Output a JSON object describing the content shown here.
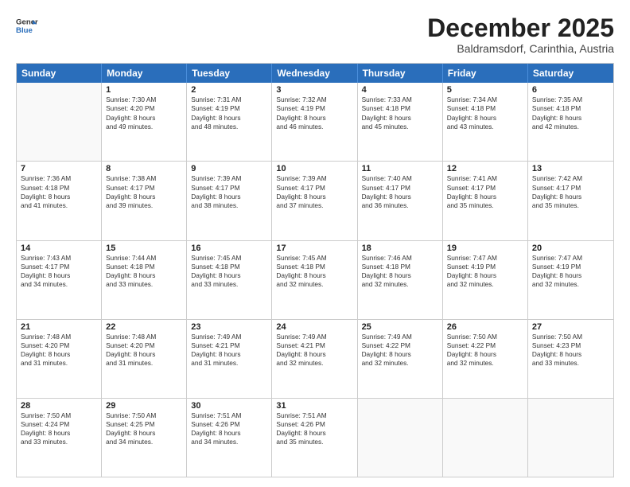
{
  "header": {
    "logo_line1": "General",
    "logo_line2": "Blue",
    "month_year": "December 2025",
    "location": "Baldramsdorf, Carinthia, Austria"
  },
  "weekdays": [
    "Sunday",
    "Monday",
    "Tuesday",
    "Wednesday",
    "Thursday",
    "Friday",
    "Saturday"
  ],
  "rows": [
    [
      {
        "day": "",
        "lines": []
      },
      {
        "day": "1",
        "lines": [
          "Sunrise: 7:30 AM",
          "Sunset: 4:20 PM",
          "Daylight: 8 hours",
          "and 49 minutes."
        ]
      },
      {
        "day": "2",
        "lines": [
          "Sunrise: 7:31 AM",
          "Sunset: 4:19 PM",
          "Daylight: 8 hours",
          "and 48 minutes."
        ]
      },
      {
        "day": "3",
        "lines": [
          "Sunrise: 7:32 AM",
          "Sunset: 4:19 PM",
          "Daylight: 8 hours",
          "and 46 minutes."
        ]
      },
      {
        "day": "4",
        "lines": [
          "Sunrise: 7:33 AM",
          "Sunset: 4:18 PM",
          "Daylight: 8 hours",
          "and 45 minutes."
        ]
      },
      {
        "day": "5",
        "lines": [
          "Sunrise: 7:34 AM",
          "Sunset: 4:18 PM",
          "Daylight: 8 hours",
          "and 43 minutes."
        ]
      },
      {
        "day": "6",
        "lines": [
          "Sunrise: 7:35 AM",
          "Sunset: 4:18 PM",
          "Daylight: 8 hours",
          "and 42 minutes."
        ]
      }
    ],
    [
      {
        "day": "7",
        "lines": [
          "Sunrise: 7:36 AM",
          "Sunset: 4:18 PM",
          "Daylight: 8 hours",
          "and 41 minutes."
        ]
      },
      {
        "day": "8",
        "lines": [
          "Sunrise: 7:38 AM",
          "Sunset: 4:17 PM",
          "Daylight: 8 hours",
          "and 39 minutes."
        ]
      },
      {
        "day": "9",
        "lines": [
          "Sunrise: 7:39 AM",
          "Sunset: 4:17 PM",
          "Daylight: 8 hours",
          "and 38 minutes."
        ]
      },
      {
        "day": "10",
        "lines": [
          "Sunrise: 7:39 AM",
          "Sunset: 4:17 PM",
          "Daylight: 8 hours",
          "and 37 minutes."
        ]
      },
      {
        "day": "11",
        "lines": [
          "Sunrise: 7:40 AM",
          "Sunset: 4:17 PM",
          "Daylight: 8 hours",
          "and 36 minutes."
        ]
      },
      {
        "day": "12",
        "lines": [
          "Sunrise: 7:41 AM",
          "Sunset: 4:17 PM",
          "Daylight: 8 hours",
          "and 35 minutes."
        ]
      },
      {
        "day": "13",
        "lines": [
          "Sunrise: 7:42 AM",
          "Sunset: 4:17 PM",
          "Daylight: 8 hours",
          "and 35 minutes."
        ]
      }
    ],
    [
      {
        "day": "14",
        "lines": [
          "Sunrise: 7:43 AM",
          "Sunset: 4:17 PM",
          "Daylight: 8 hours",
          "and 34 minutes."
        ]
      },
      {
        "day": "15",
        "lines": [
          "Sunrise: 7:44 AM",
          "Sunset: 4:18 PM",
          "Daylight: 8 hours",
          "and 33 minutes."
        ]
      },
      {
        "day": "16",
        "lines": [
          "Sunrise: 7:45 AM",
          "Sunset: 4:18 PM",
          "Daylight: 8 hours",
          "and 33 minutes."
        ]
      },
      {
        "day": "17",
        "lines": [
          "Sunrise: 7:45 AM",
          "Sunset: 4:18 PM",
          "Daylight: 8 hours",
          "and 32 minutes."
        ]
      },
      {
        "day": "18",
        "lines": [
          "Sunrise: 7:46 AM",
          "Sunset: 4:18 PM",
          "Daylight: 8 hours",
          "and 32 minutes."
        ]
      },
      {
        "day": "19",
        "lines": [
          "Sunrise: 7:47 AM",
          "Sunset: 4:19 PM",
          "Daylight: 8 hours",
          "and 32 minutes."
        ]
      },
      {
        "day": "20",
        "lines": [
          "Sunrise: 7:47 AM",
          "Sunset: 4:19 PM",
          "Daylight: 8 hours",
          "and 32 minutes."
        ]
      }
    ],
    [
      {
        "day": "21",
        "lines": [
          "Sunrise: 7:48 AM",
          "Sunset: 4:20 PM",
          "Daylight: 8 hours",
          "and 31 minutes."
        ]
      },
      {
        "day": "22",
        "lines": [
          "Sunrise: 7:48 AM",
          "Sunset: 4:20 PM",
          "Daylight: 8 hours",
          "and 31 minutes."
        ]
      },
      {
        "day": "23",
        "lines": [
          "Sunrise: 7:49 AM",
          "Sunset: 4:21 PM",
          "Daylight: 8 hours",
          "and 31 minutes."
        ]
      },
      {
        "day": "24",
        "lines": [
          "Sunrise: 7:49 AM",
          "Sunset: 4:21 PM",
          "Daylight: 8 hours",
          "and 32 minutes."
        ]
      },
      {
        "day": "25",
        "lines": [
          "Sunrise: 7:49 AM",
          "Sunset: 4:22 PM",
          "Daylight: 8 hours",
          "and 32 minutes."
        ]
      },
      {
        "day": "26",
        "lines": [
          "Sunrise: 7:50 AM",
          "Sunset: 4:22 PM",
          "Daylight: 8 hours",
          "and 32 minutes."
        ]
      },
      {
        "day": "27",
        "lines": [
          "Sunrise: 7:50 AM",
          "Sunset: 4:23 PM",
          "Daylight: 8 hours",
          "and 33 minutes."
        ]
      }
    ],
    [
      {
        "day": "28",
        "lines": [
          "Sunrise: 7:50 AM",
          "Sunset: 4:24 PM",
          "Daylight: 8 hours",
          "and 33 minutes."
        ]
      },
      {
        "day": "29",
        "lines": [
          "Sunrise: 7:50 AM",
          "Sunset: 4:25 PM",
          "Daylight: 8 hours",
          "and 34 minutes."
        ]
      },
      {
        "day": "30",
        "lines": [
          "Sunrise: 7:51 AM",
          "Sunset: 4:26 PM",
          "Daylight: 8 hours",
          "and 34 minutes."
        ]
      },
      {
        "day": "31",
        "lines": [
          "Sunrise: 7:51 AM",
          "Sunset: 4:26 PM",
          "Daylight: 8 hours",
          "and 35 minutes."
        ]
      },
      {
        "day": "",
        "lines": []
      },
      {
        "day": "",
        "lines": []
      },
      {
        "day": "",
        "lines": []
      }
    ]
  ]
}
